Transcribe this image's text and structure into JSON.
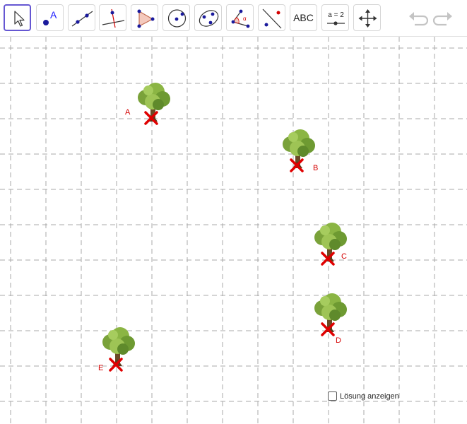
{
  "toolbar": {
    "tools": [
      {
        "name": "move",
        "icon": "pointer-arrow-icon"
      },
      {
        "name": "point",
        "icon": "point-icon",
        "letter": "A"
      },
      {
        "name": "line",
        "icon": "line-icon"
      },
      {
        "name": "perpendicular",
        "icon": "perpendicular-line-icon"
      },
      {
        "name": "polygon",
        "icon": "polygon-icon"
      },
      {
        "name": "circle",
        "icon": "circle-icon"
      },
      {
        "name": "ellipse",
        "icon": "ellipse-icon"
      },
      {
        "name": "angle",
        "icon": "angle-icon",
        "letter": "α"
      },
      {
        "name": "reflect",
        "icon": "reflect-icon"
      },
      {
        "name": "text",
        "icon": "text-icon",
        "label": "ABC"
      },
      {
        "name": "slider",
        "icon": "slider-icon",
        "label": "a = 2"
      },
      {
        "name": "move-view",
        "icon": "move-graphics-view-icon"
      }
    ],
    "undo_icon": "undo-icon",
    "redo_icon": "redo-icon"
  },
  "points": [
    {
      "label": "A"
    },
    {
      "label": "B"
    },
    {
      "label": "C"
    },
    {
      "label": "D"
    },
    {
      "label": "E"
    }
  ],
  "solution_checkbox": {
    "label": "Lösung anzeigen",
    "checked": false
  },
  "colors": {
    "accent": "#6557d2",
    "point_label": "#d40000",
    "marker": "#e00000",
    "grid": "#a8a8a8"
  }
}
